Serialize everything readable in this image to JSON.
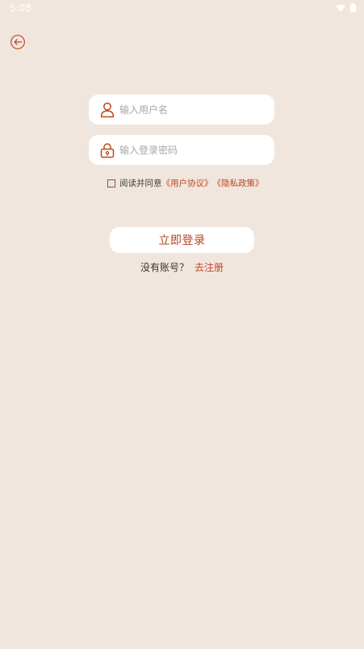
{
  "status_bar": {
    "time": "5:08",
    "wifi_icon": "wifi-icon",
    "battery_icon": "battery-icon"
  },
  "header": {
    "back_icon": "back-arrow-icon"
  },
  "form": {
    "username": {
      "icon": "user-icon",
      "placeholder": "输入用户名",
      "value": ""
    },
    "password": {
      "icon": "lock-icon",
      "placeholder": "输入登录密码",
      "value": ""
    },
    "agreement": {
      "checked": false,
      "prefix": "阅读并同意",
      "user_agreement": "《用户协议》",
      "privacy_policy": "《隐私政策》"
    },
    "login_label": "立即登录",
    "register": {
      "prompt": "没有账号？",
      "link": "去注册"
    }
  },
  "colors": {
    "background": "#f0e6de",
    "accent": "#c0461f",
    "field_bg": "#ffffff",
    "placeholder": "#a7a7a7"
  }
}
